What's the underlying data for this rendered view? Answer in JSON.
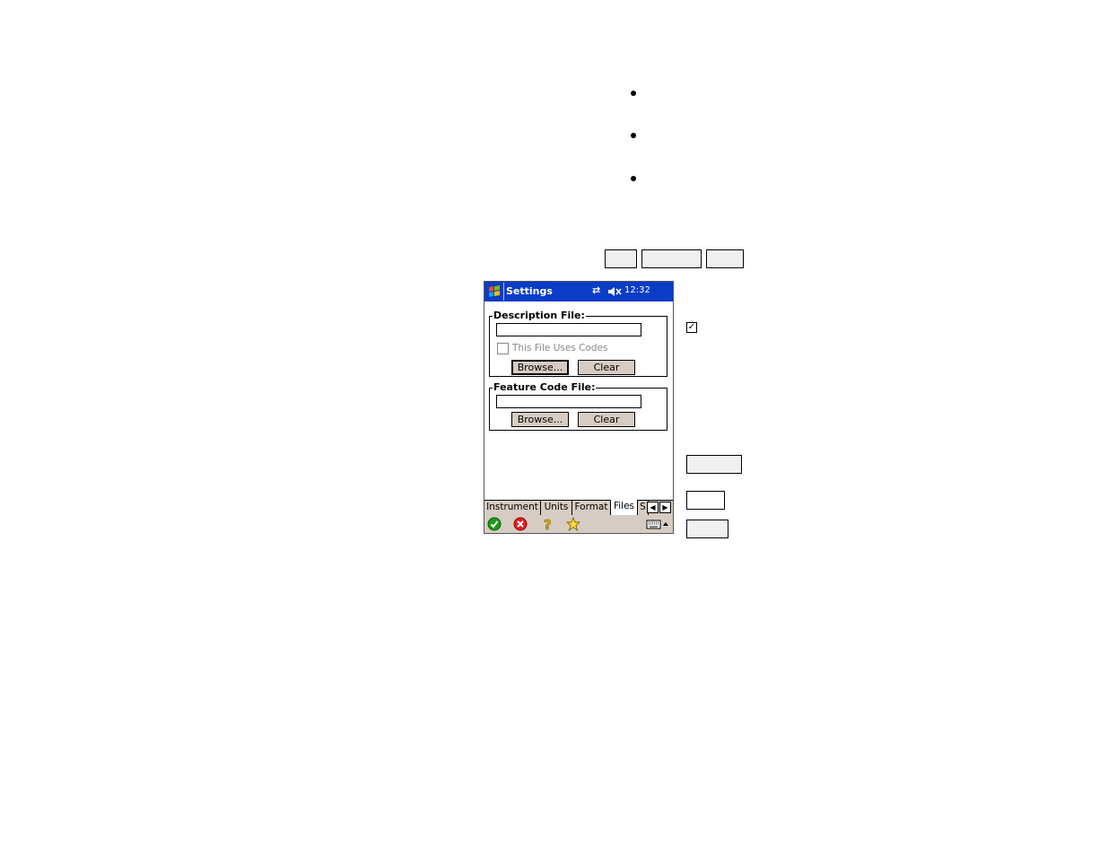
{
  "device": {
    "title": "Settings",
    "clock": "12:32",
    "description_group": {
      "label": "Description File:",
      "file_value": "",
      "checkbox_label": "This File Uses Codes",
      "checkbox_checked": false,
      "browse_label": "Browse...",
      "clear_label": "Clear"
    },
    "feature_group": {
      "label": "Feature Code File:",
      "file_value": "",
      "browse_label": "Browse...",
      "clear_label": "Clear"
    },
    "tabs": [
      {
        "label": "Instrument",
        "active": false
      },
      {
        "label": "Units",
        "active": false
      },
      {
        "label": "Format",
        "active": false
      },
      {
        "label": "Files",
        "active": true
      },
      {
        "label": "S",
        "active": false
      }
    ],
    "icons": {
      "start": "windows-flag-icon",
      "connectivity": "sync-arrows-icon",
      "volume": "speaker-muted-icon",
      "ok": "green-check-icon",
      "cancel": "red-x-icon",
      "help": "question-icon",
      "favorite": "star-icon",
      "keyboard": "keyboard-icon",
      "sip_menu": "up-arrow-icon"
    },
    "colors": {
      "titlebar": "#0a3cc6",
      "chrome": "#d6ccc3"
    }
  }
}
